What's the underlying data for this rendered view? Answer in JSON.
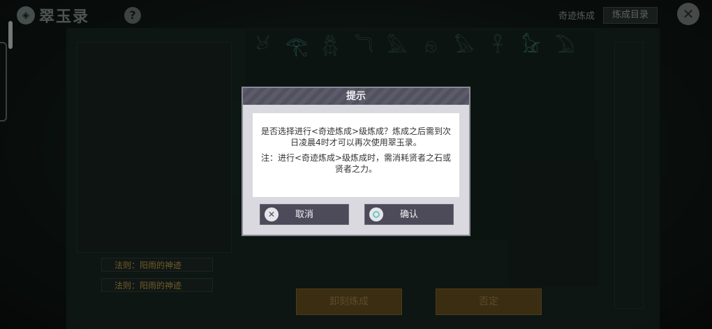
{
  "header": {
    "logo_text": "翠玉录",
    "help_glyph": "?",
    "tab_label": "奇迹炼成",
    "catalog_button": "炼成目录",
    "close_glyph": "✕"
  },
  "glyphs": {
    "row1": [
      "𓃾",
      "𓂀",
      "𓆣",
      "𓆓",
      "𓅓",
      "𓁶",
      "𓅃",
      "𓋹",
      "𓃠",
      "𓅐"
    ]
  },
  "rules": [
    {
      "label": "法则：阳雨的神迹"
    },
    {
      "label": "法则：阳雨的神迹"
    }
  ],
  "bottom_buttons": {
    "engrave": "卸刻炼成",
    "deny": "否定"
  },
  "dialog": {
    "title": "提示",
    "message": "是否选择进行<奇迹炼成>级炼成？炼成之后需到次日凌晨4时才可以再次使用翠玉录。",
    "note": "注：进行<奇迹炼成>级炼成时，需消耗贤者之石或贤者之力。",
    "cancel_label": "取消",
    "confirm_label": "确认",
    "cancel_icon": "✕"
  },
  "colors": {
    "accent_gold": "#c9a64a",
    "dialog_button": "#4d4b5a",
    "teal_glow": "#4fa999"
  }
}
